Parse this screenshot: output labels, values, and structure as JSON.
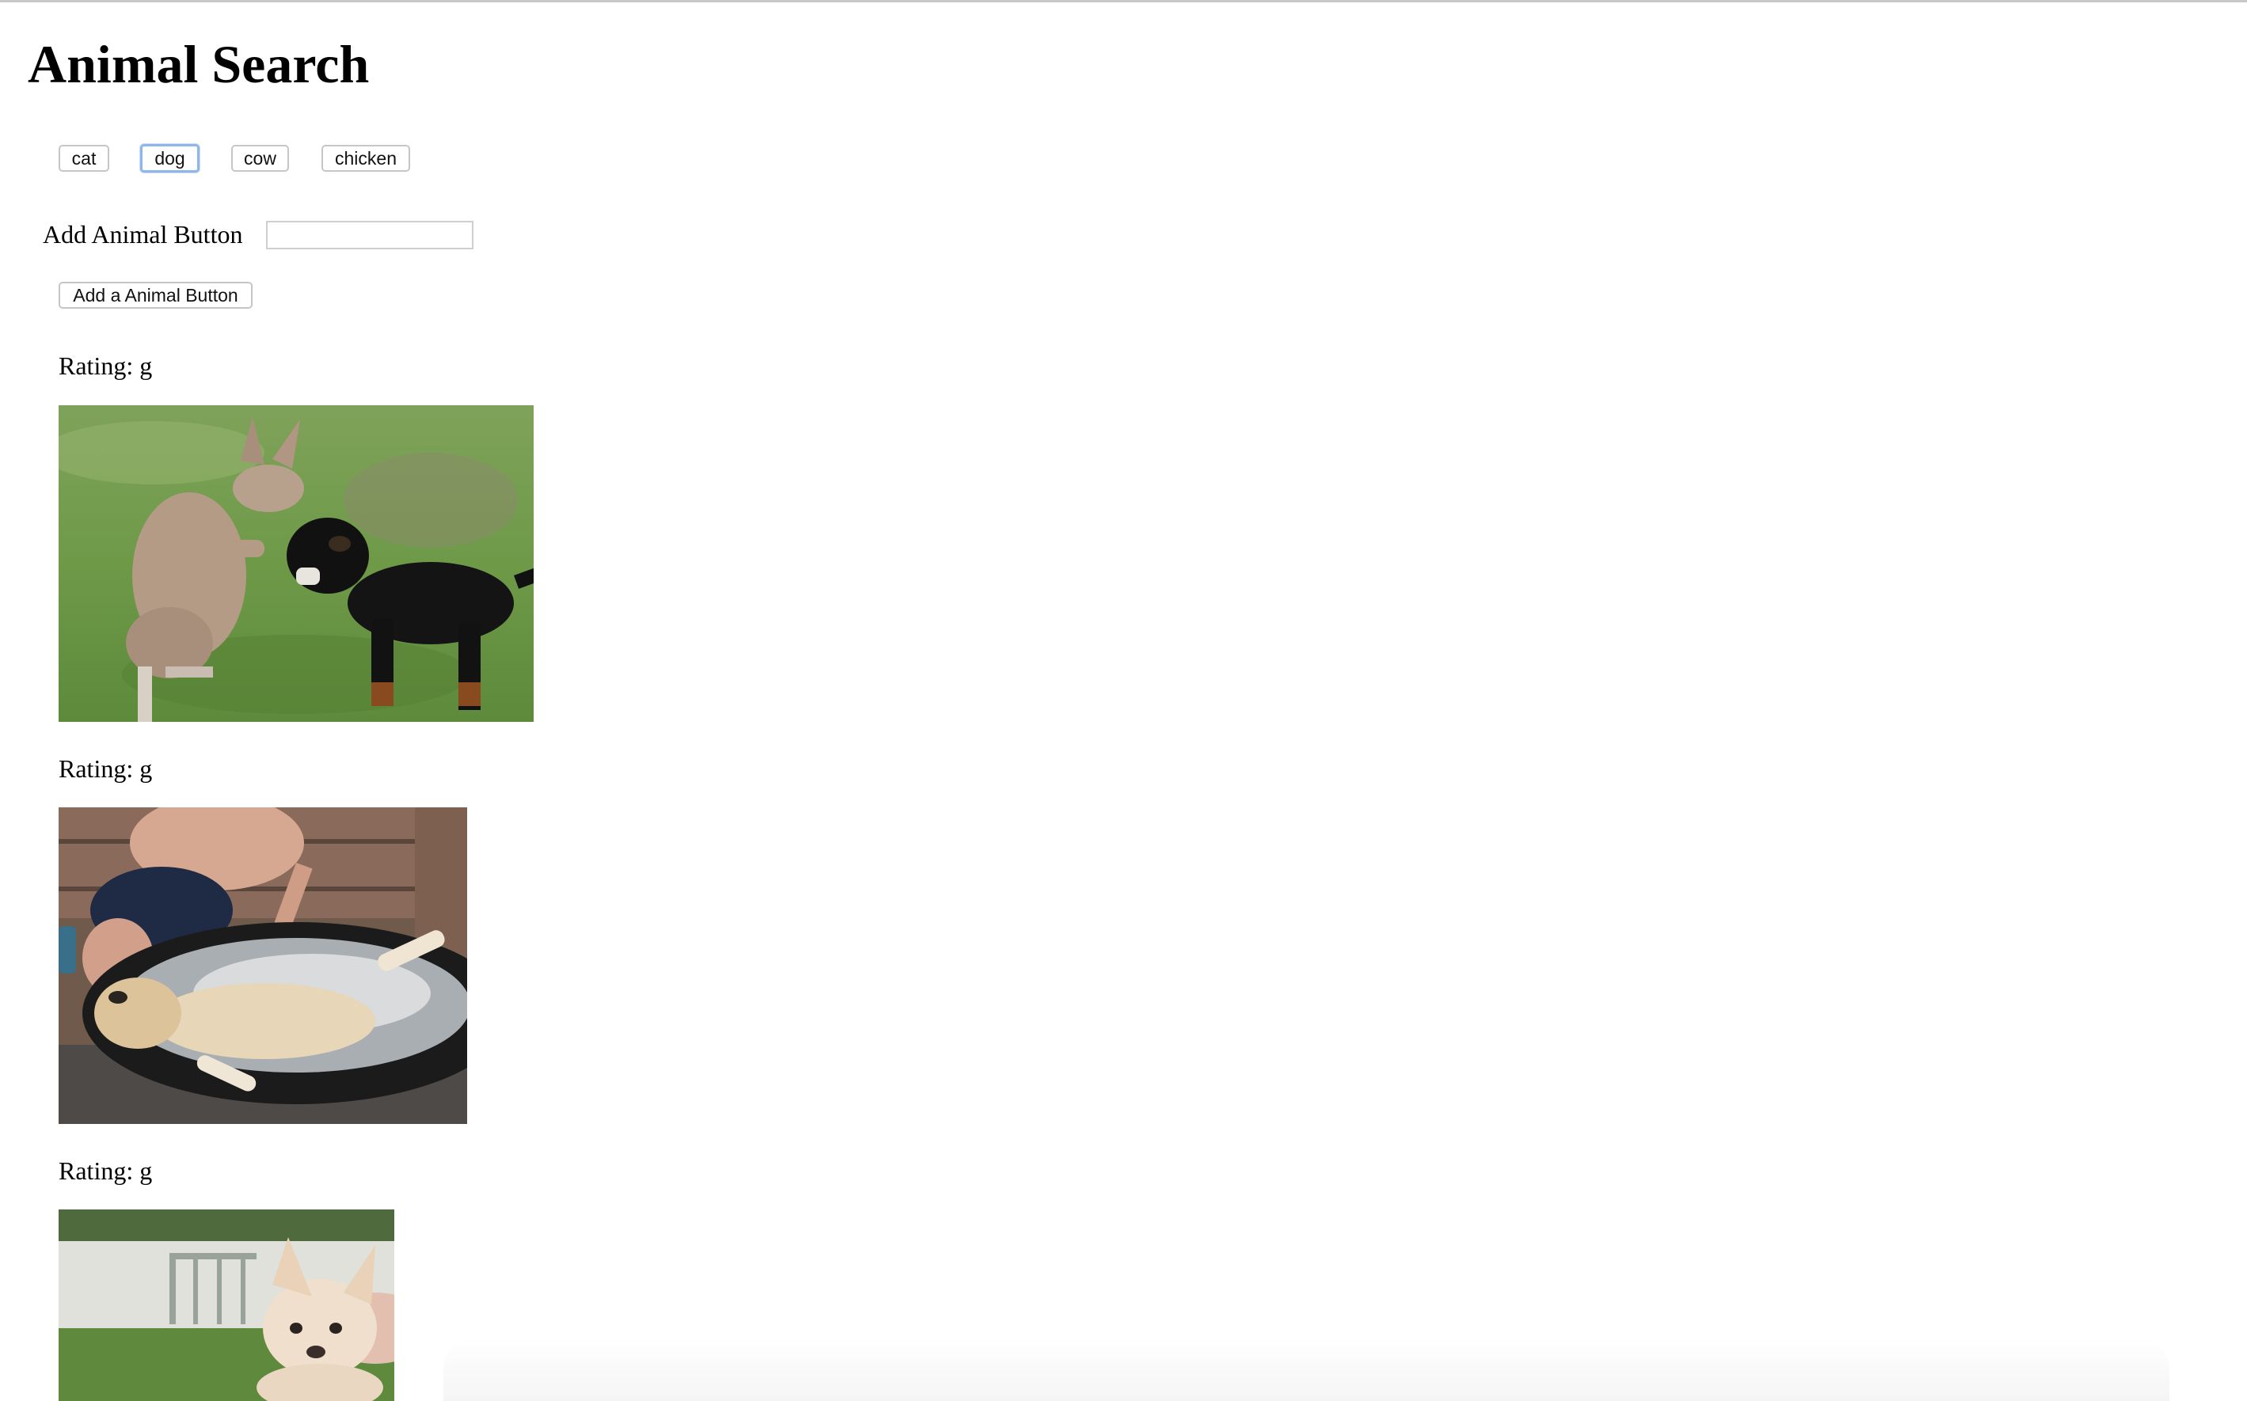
{
  "header": {
    "title": "Animal Search"
  },
  "animal_buttons": [
    {
      "label": "cat"
    },
    {
      "label": "dog",
      "focused": true
    },
    {
      "label": "cow"
    },
    {
      "label": "chicken"
    }
  ],
  "add_form": {
    "label": "Add Animal Button",
    "input_value": "",
    "submit_label": "Add a Animal Button"
  },
  "results": [
    {
      "rating_label": "Rating: g",
      "image_icon": "kangaroo-and-dog-gif"
    },
    {
      "rating_label": "Rating: g",
      "image_icon": "dog-bath-gif"
    },
    {
      "rating_label": "Rating: g",
      "image_icon": "puppy-gif"
    }
  ],
  "colors": {
    "focus_ring": "#8fb6ea",
    "button_border": "#c6c6c6"
  }
}
